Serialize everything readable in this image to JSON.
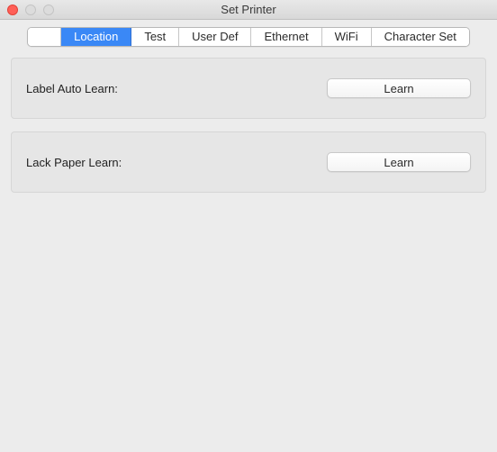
{
  "window": {
    "title": "Set Printer"
  },
  "tabs": {
    "items": [
      {
        "label": "",
        "active": false
      },
      {
        "label": "Location",
        "active": true
      },
      {
        "label": "Test",
        "active": false
      },
      {
        "label": "User Def",
        "active": false
      },
      {
        "label": "Ethernet",
        "active": false
      },
      {
        "label": "WiFi",
        "active": false
      },
      {
        "label": "Character Set",
        "active": false
      }
    ]
  },
  "panels": {
    "labelAutoLearn": {
      "label": "Label Auto Learn:",
      "button": "Learn"
    },
    "lackPaperLearn": {
      "label": "Lack Paper Learn:",
      "button": "Learn"
    }
  }
}
